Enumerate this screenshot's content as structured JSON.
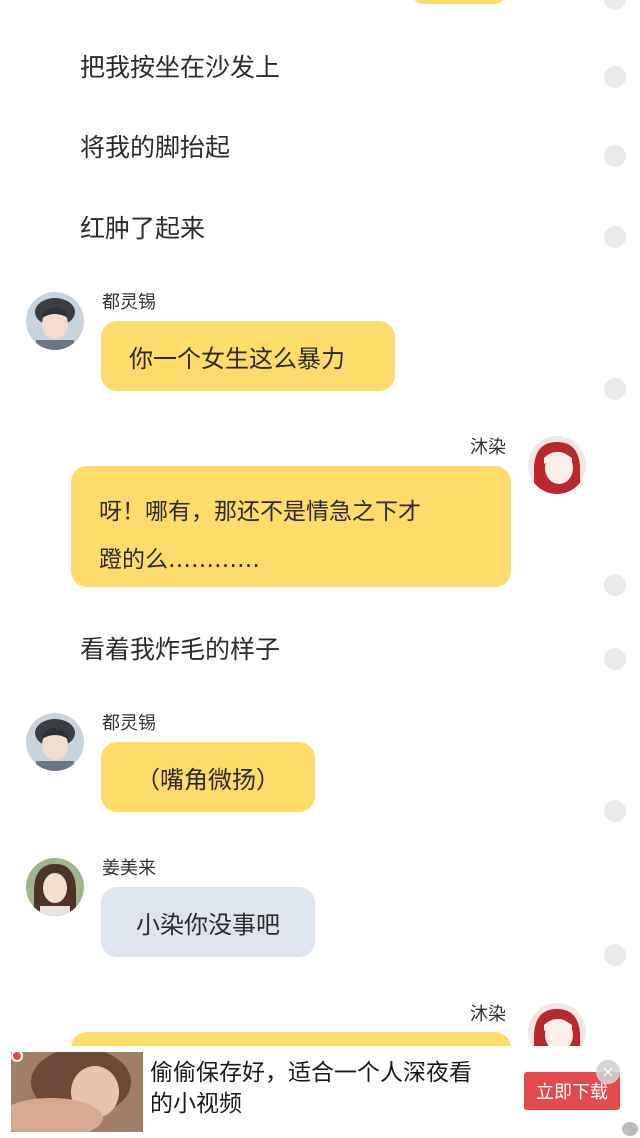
{
  "colors": {
    "bubble_yellow": "#fedc6b",
    "bubble_blue": "#dde4ed",
    "ad_button": "#e24a4e"
  },
  "narration": [
    "把我按坐在沙发上",
    "将我的脚抬起",
    "红肿了起来",
    "看着我炸毛的样子"
  ],
  "messages": [
    {
      "sender": "都灵锡",
      "text": "你一个女生这么暴力"
    },
    {
      "sender": "沐染",
      "line1": "呀！哪有，那还不是情急之下才",
      "line2": "蹬的么…………"
    },
    {
      "sender": "都灵锡",
      "text": "（嘴角微扬）"
    },
    {
      "sender": "姜美来",
      "text": "小染你没事吧"
    },
    {
      "sender": "沐染"
    }
  ],
  "ad": {
    "line1": "偷偷保存好，适合一个人深夜看",
    "line2": "的小视频",
    "button": "立即下载",
    "close": "×"
  },
  "icons": [
    "avatar-male",
    "avatar-female-red",
    "avatar-female-brown",
    "close-icon"
  ]
}
